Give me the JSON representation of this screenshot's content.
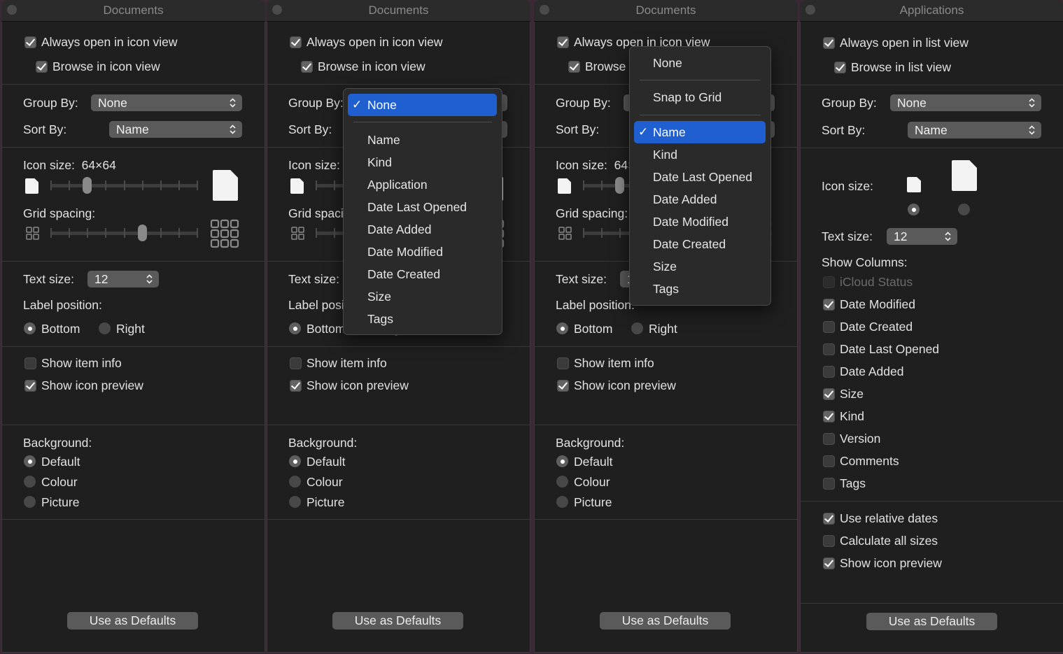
{
  "icon_view": {
    "title": "Documents",
    "always_open": "Always open in icon view",
    "browse": "Browse in icon view",
    "group_by_label": "Group By:",
    "group_by_value": "None",
    "sort_by_label": "Sort By:",
    "sort_by_value": "Name",
    "icon_size_label": "Icon size:",
    "icon_size_value": "64×64",
    "icon_size_slider_step": 2,
    "icon_size_slider_steps": 9,
    "grid_spacing_label": "Grid spacing:",
    "grid_spacing_slider_step": 5,
    "grid_spacing_slider_steps": 9,
    "text_size_label": "Text size:",
    "text_size_value": "12",
    "label_position_label": "Label position:",
    "label_bottom": "Bottom",
    "label_right": "Right",
    "show_item_info": "Show item info",
    "show_icon_preview": "Show icon preview",
    "background_label": "Background:",
    "bg_default": "Default",
    "bg_colour": "Colour",
    "bg_picture": "Picture",
    "use_as_defaults": "Use as Defaults"
  },
  "group_menu": {
    "selected": "None",
    "items": [
      "Name",
      "Kind",
      "Application",
      "Date Last Opened",
      "Date Added",
      "Date Modified",
      "Date Created",
      "Size",
      "Tags"
    ]
  },
  "sort_menu": {
    "none": "None",
    "snap": "Snap to Grid",
    "selected": "Name",
    "items": [
      "Kind",
      "Date Last Opened",
      "Date Added",
      "Date Modified",
      "Date Created",
      "Size",
      "Tags"
    ]
  },
  "list_view": {
    "title": "Applications",
    "always_open": "Always open in list view",
    "browse": "Browse in list view",
    "group_by_label": "Group By:",
    "group_by_value": "None",
    "sort_by_label": "Sort By:",
    "sort_by_value": "Name",
    "icon_size_label": "Icon size:",
    "text_size_label": "Text size:",
    "text_size_value": "12",
    "show_columns_label": "Show Columns:",
    "columns": [
      {
        "label": "iCloud Status",
        "checked": false,
        "disabled": true
      },
      {
        "label": "Date Modified",
        "checked": true
      },
      {
        "label": "Date Created",
        "checked": false
      },
      {
        "label": "Date Last Opened",
        "checked": false
      },
      {
        "label": "Date Added",
        "checked": false
      },
      {
        "label": "Size",
        "checked": true
      },
      {
        "label": "Kind",
        "checked": true
      },
      {
        "label": "Version",
        "checked": false
      },
      {
        "label": "Comments",
        "checked": false
      },
      {
        "label": "Tags",
        "checked": false
      }
    ],
    "use_relative_dates": "Use relative dates",
    "calculate_all_sizes": "Calculate all sizes",
    "show_icon_preview": "Show icon preview",
    "use_as_defaults": "Use as Defaults"
  },
  "colors": {
    "accent": "#1f5fd0",
    "panel": "#1f1f1f",
    "control": "#5a5a5a"
  }
}
